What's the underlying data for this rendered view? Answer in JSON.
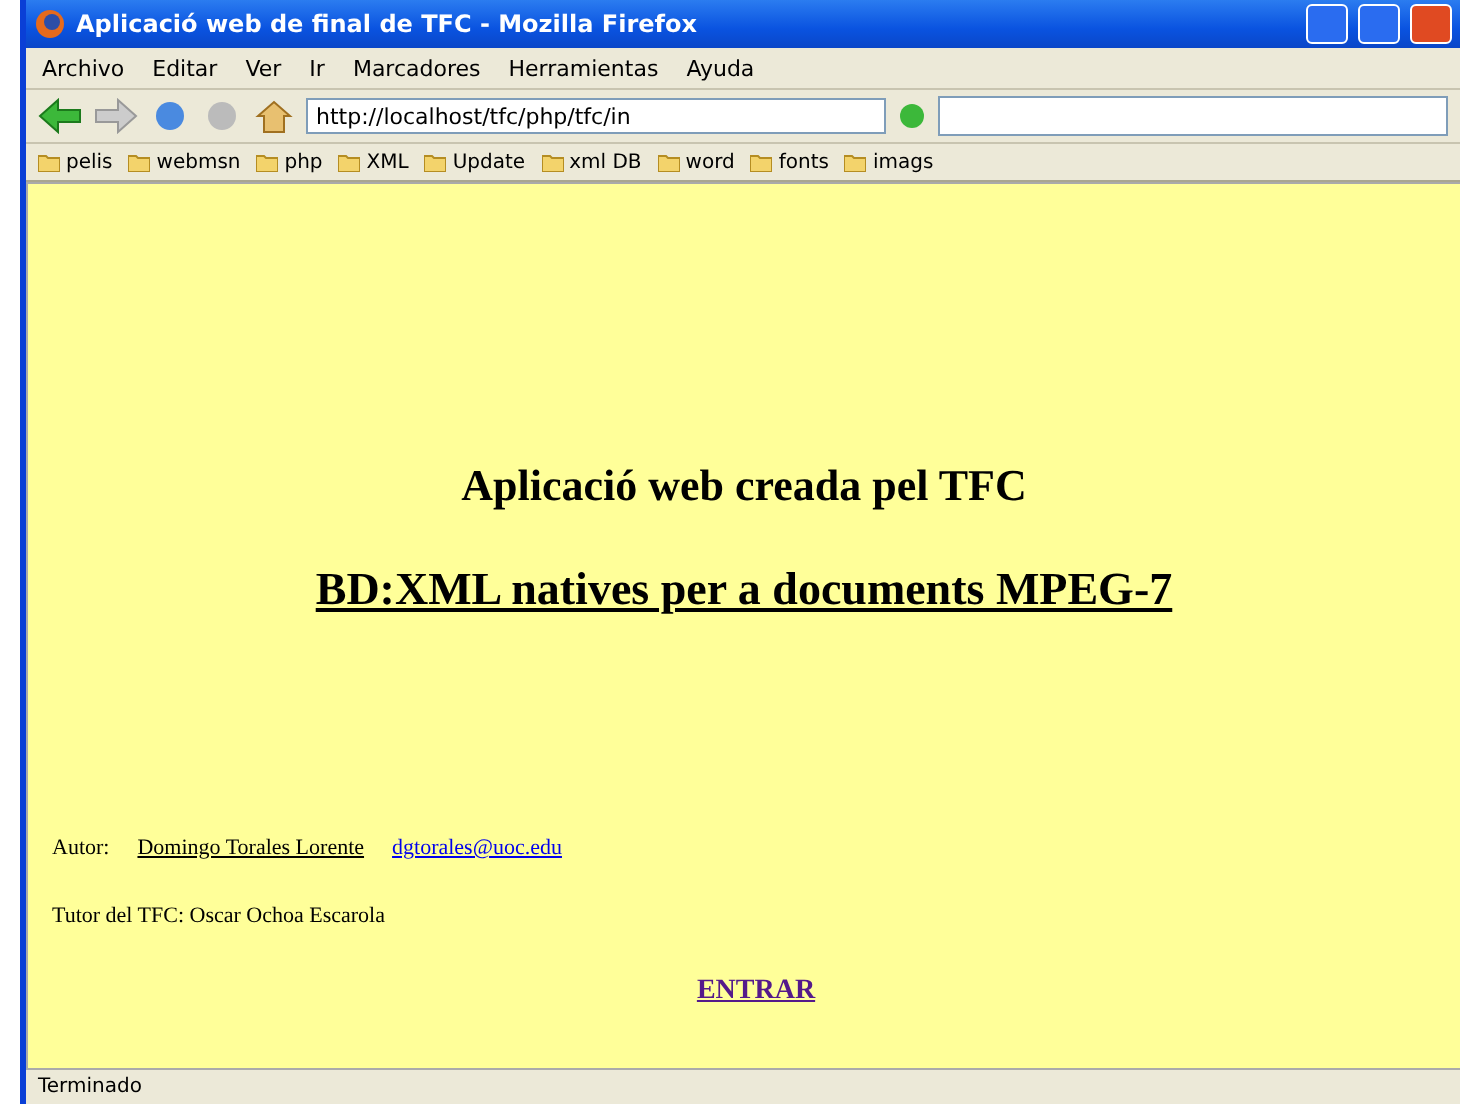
{
  "window": {
    "title": "Aplicació web de final de TFC - Mozilla Firefox"
  },
  "menu": [
    "Archivo",
    "Editar",
    "Ver",
    "Ir",
    "Marcadores",
    "Herramientas",
    "Ayuda"
  ],
  "address": {
    "value": "http://localhost/tfc/php/tfc/in"
  },
  "bookmarks": [
    "pelis",
    "webmsn",
    "php",
    "XML",
    "Update",
    "xml DB",
    "word",
    "fonts",
    "imags"
  ],
  "page": {
    "title": "Aplicació web creada pel TFC",
    "subtitle": "BD:XML natives per a documents MPEG-7",
    "author_label": "Autor:",
    "author": "Domingo Torales Lorente",
    "email": "dgtorales@uoc.edu",
    "tutor": "Tutor del TFC: Oscar Ochoa Escarola",
    "enter": "ENTRAR"
  },
  "status_bar": "Terminado"
}
